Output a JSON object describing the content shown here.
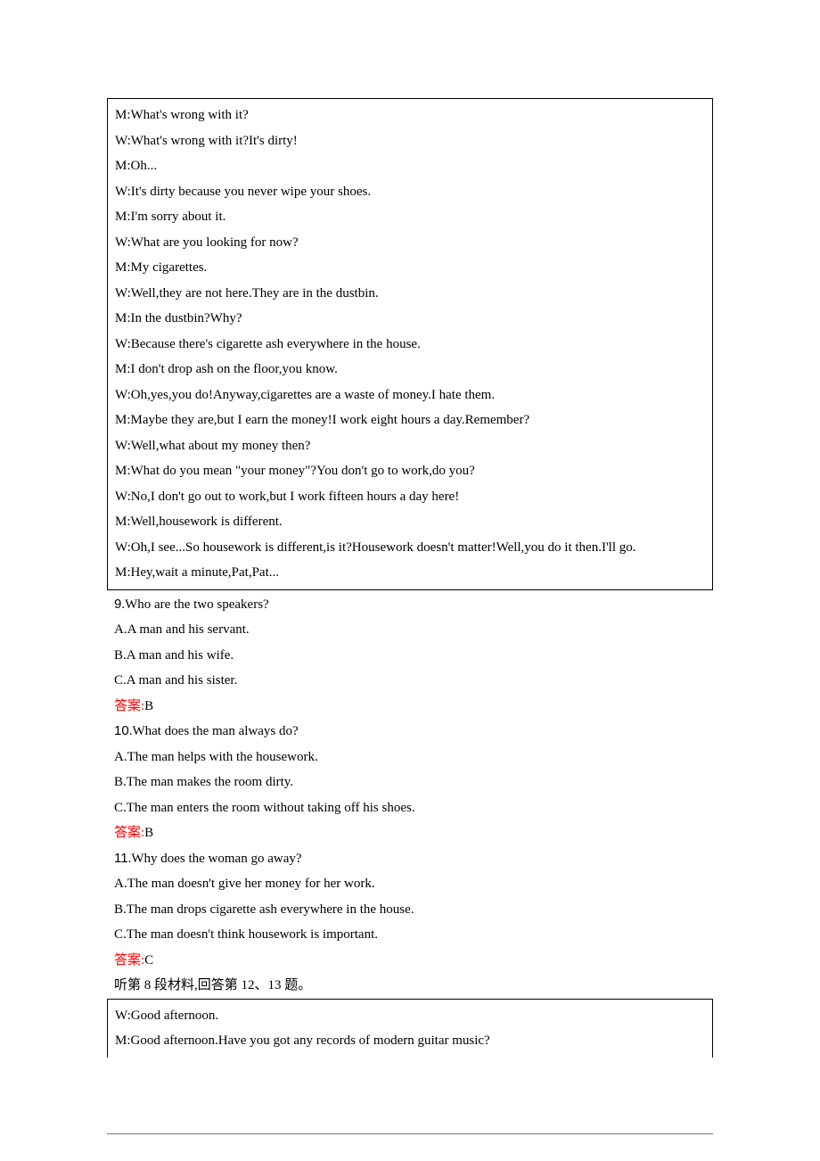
{
  "dialog1": {
    "lines": [
      "M:What's wrong with it?",
      "W:What's wrong with it?It's dirty!",
      "M:Oh...",
      "W:It's dirty because you never wipe your shoes.",
      "M:I'm sorry about it.",
      "W:What are you looking for now?",
      "M:My cigarettes.",
      "W:Well,they are not here.They are in the dustbin.",
      "M:In the dustbin?Why?",
      "W:Because there's cigarette ash everywhere in the house.",
      "M:I don't drop ash on the floor,you know.",
      "W:Oh,yes,you do!Anyway,cigarettes are a waste of money.I hate them.",
      "M:Maybe they are,but I earn the money!I work eight hours a day.Remember?",
      "W:Well,what about my money then?",
      "M:What do you mean \"your money\"?You don't go to work,do you?",
      "W:No,I don't go out to work,but I work fifteen hours a day here!",
      "M:Well,housework is different.",
      "W:Oh,I see...So housework is different,is it?Housework doesn't matter!Well,you do it then.I'll go.",
      "M:Hey,wait a minute,Pat,Pat..."
    ]
  },
  "q9": {
    "num": "9",
    "stem": ".Who are the two speakers?",
    "a": "A.A man and his servant.",
    "b": "B.A man and his wife.",
    "c": "C.A man and his sister.",
    "ansLabel": "答案:",
    "ans": "B"
  },
  "q10": {
    "num": "10",
    "stem": ".What does the man always do?",
    "a": "A.The man helps with the housework.",
    "b": "B.The man makes the room dirty.",
    "c": "C.The man enters the room without taking off his shoes.",
    "ansLabel": "答案:",
    "ans": "B"
  },
  "q11": {
    "num": "11",
    "stem": ".Why does the woman go away?",
    "a": "A.The man doesn't give her money for her work.",
    "b": "B.The man drops cigarette ash everywhere in the house.",
    "c": "C.The man doesn't think housework is important.",
    "ansLabel": "答案:",
    "ans": "C"
  },
  "instr": "听第 8 段材料,回答第 12、13 题。",
  "dialog2": {
    "lines": [
      "W:Good afternoon.",
      "M:Good afternoon.Have you got any records of modern guitar music?"
    ]
  }
}
